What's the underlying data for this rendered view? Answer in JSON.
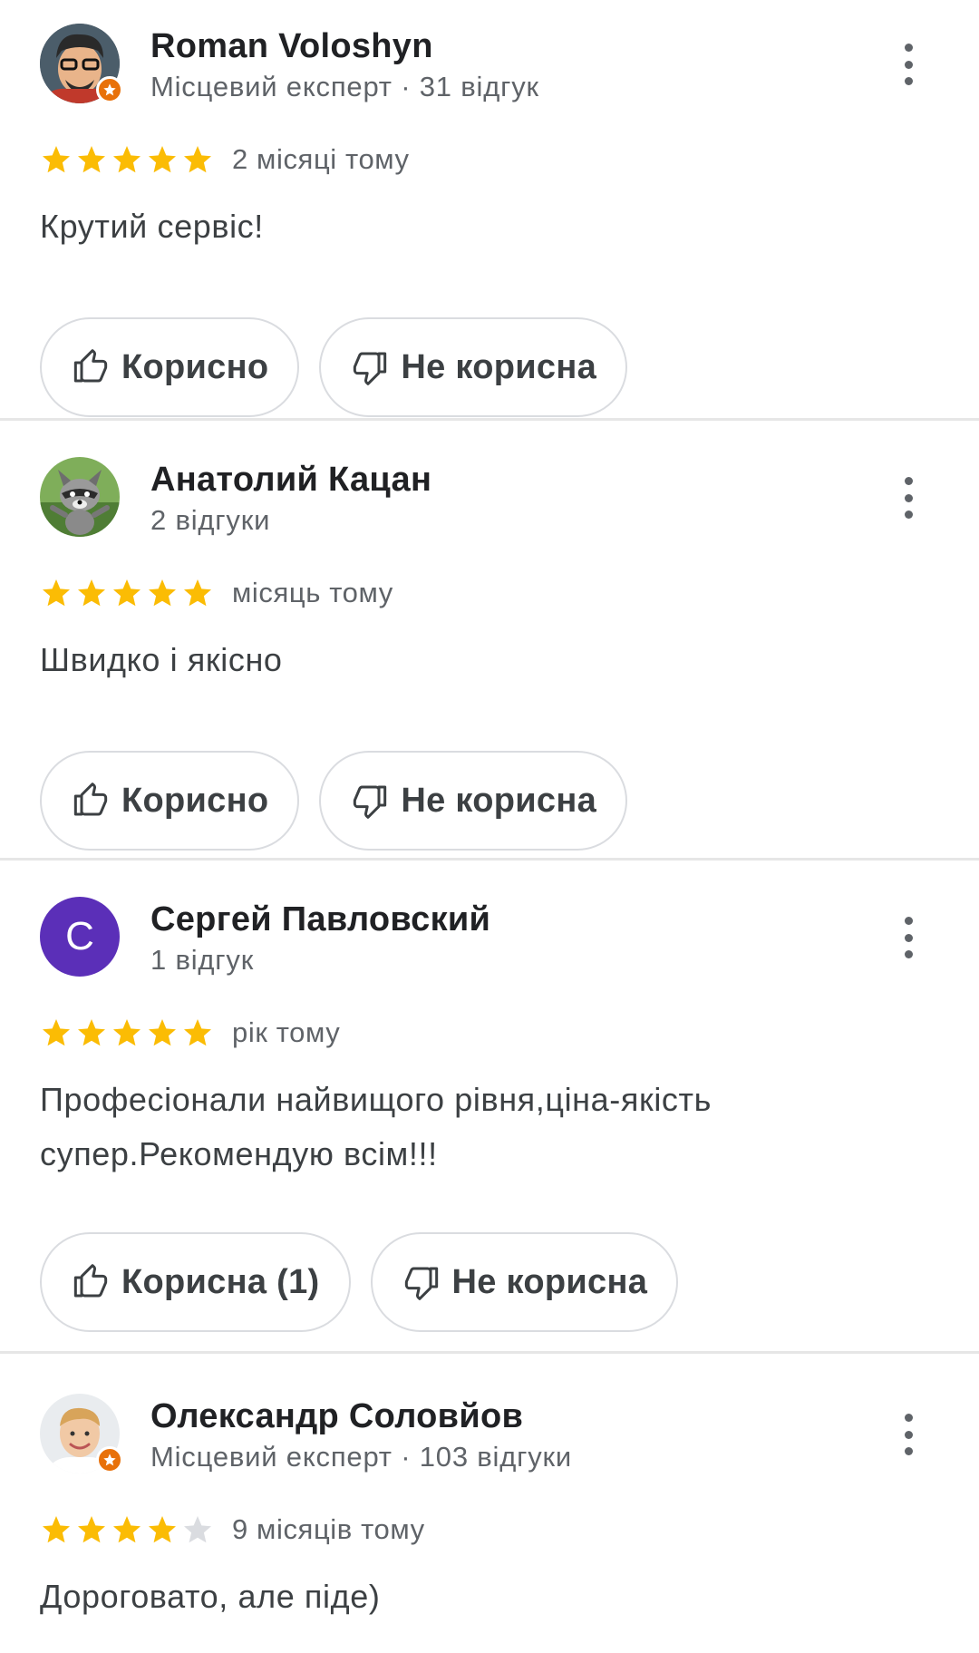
{
  "icons": {
    "more": "more-vert-icon",
    "helpful": "thumb-up-icon",
    "not_helpful": "thumb-down-icon",
    "local_guide_badge": "star-badge-icon"
  },
  "colors": {
    "star_filled": "#fbbc04",
    "star_empty": "#dadce0",
    "local_guide_badge": "#e8710a",
    "letter_avatar_bg": "#5b2fb8"
  },
  "reviews": [
    {
      "author": "Roman Voloshyn",
      "subtitle": "Місцевий експерт · 31 відгук",
      "local_guide": true,
      "rating": 5,
      "time": "2 місяці тому",
      "text": "Крутий сервіс!",
      "helpful_label": "Корисно",
      "not_helpful_label": "Не корисна"
    },
    {
      "author": "Анатолий Кацан",
      "subtitle": "2 відгуки",
      "local_guide": false,
      "rating": 5,
      "time": "місяць тому",
      "text": "Швидко і якісно",
      "helpful_label": "Корисно",
      "not_helpful_label": "Не корисна"
    },
    {
      "author": "Сергей Павловский",
      "avatar_letter": "С",
      "subtitle": "1 відгук",
      "local_guide": false,
      "rating": 5,
      "time": "рік тому",
      "text": "Професіонали найвищого рівня,ціна-якість супер.Рекомендую всім!!!",
      "helpful_label": "Корисна (1)",
      "not_helpful_label": "Не корисна"
    },
    {
      "author": "Олександр Соловйов",
      "subtitle": "Місцевий експерт · 103 відгуки",
      "local_guide": true,
      "rating": 4,
      "time": "9 місяців тому",
      "text": "Дороговато, але піде)"
    }
  ]
}
